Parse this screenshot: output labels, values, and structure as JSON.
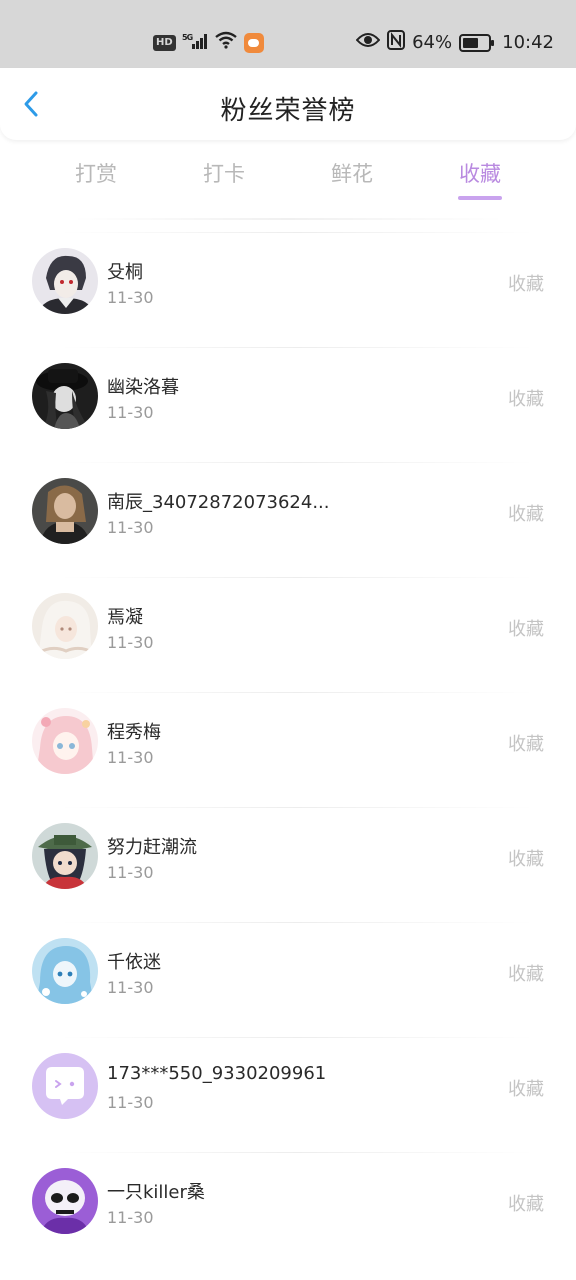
{
  "status_bar": {
    "hd": "HD",
    "network": "5G",
    "battery_percent": "64%",
    "battery_level": 0.64,
    "time": "10:42"
  },
  "header": {
    "title": "粉丝荣誉榜"
  },
  "tabs": [
    {
      "label": "打赏",
      "active": false
    },
    {
      "label": "打卡",
      "active": false
    },
    {
      "label": "鲜花",
      "active": false
    },
    {
      "label": "收藏",
      "active": true
    }
  ],
  "colors": {
    "accent": "#b98ae0",
    "back_icon": "#2d9be8"
  },
  "fans": [
    {
      "name": "殳桐",
      "date": "11-30",
      "type": "收藏",
      "avatar": "anime-dark-hair"
    },
    {
      "name": "幽染洛暮",
      "date": "11-30",
      "type": "收藏",
      "avatar": "anime-black-hat"
    },
    {
      "name": "南辰_34072872073624...",
      "date": "11-30",
      "type": "收藏",
      "avatar": "photo-girl"
    },
    {
      "name": "焉凝",
      "date": "11-30",
      "type": "收藏",
      "avatar": "anime-white-hair"
    },
    {
      "name": "程秀梅",
      "date": "11-30",
      "type": "收藏",
      "avatar": "anime-pink"
    },
    {
      "name": "努力赶潮流",
      "date": "11-30",
      "type": "收藏",
      "avatar": "anime-hat-red"
    },
    {
      "name": "千依迷",
      "date": "11-30",
      "type": "收藏",
      "avatar": "anime-blue"
    },
    {
      "name": "173***550_9330209961",
      "date": "11-30",
      "type": "收藏",
      "avatar": "default-chat-bubble"
    },
    {
      "name": "一只killer桑",
      "date": "11-30",
      "type": "收藏",
      "avatar": "skull-purple"
    }
  ]
}
